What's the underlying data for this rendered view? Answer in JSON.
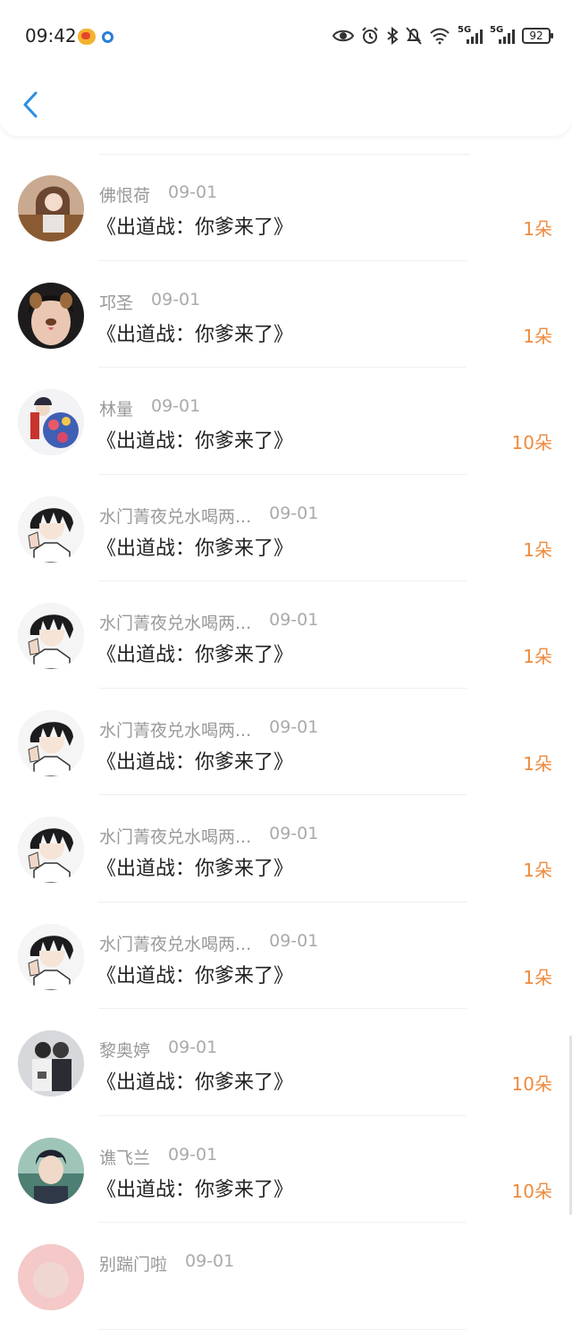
{
  "status_bar": {
    "time": "09:42",
    "battery": "92",
    "network_1": "5G",
    "network_2": "5G"
  },
  "colors": {
    "accent_orange": "#ef8a3c",
    "back_blue": "#2b8fe0"
  },
  "header": {
    "back_icon": "chevron-left-icon"
  },
  "rows": [
    {
      "name": "佛恨荷",
      "date": "09-01",
      "title": "《出道战：你爹来了》",
      "count": "1朵",
      "avatar": "photo-girl"
    },
    {
      "name": "邛圣",
      "date": "09-01",
      "title": "《出道战：你爹来了》",
      "count": "1朵",
      "avatar": "dog-filter-face"
    },
    {
      "name": "林量",
      "date": "09-01",
      "title": "《出道战：你爹来了》",
      "count": "10朵",
      "avatar": "anime-girl-flowers"
    },
    {
      "name": "水门菁夜兑水喝两...",
      "date": "09-01",
      "title": "《出道战：你爹来了》",
      "count": "1朵",
      "avatar": "anime-boy"
    },
    {
      "name": "水门菁夜兑水喝两...",
      "date": "09-01",
      "title": "《出道战：你爹来了》",
      "count": "1朵",
      "avatar": "anime-boy"
    },
    {
      "name": "水门菁夜兑水喝两...",
      "date": "09-01",
      "title": "《出道战：你爹来了》",
      "count": "1朵",
      "avatar": "anime-boy"
    },
    {
      "name": "水门菁夜兑水喝两...",
      "date": "09-01",
      "title": "《出道战：你爹来了》",
      "count": "1朵",
      "avatar": "anime-boy"
    },
    {
      "name": "水门菁夜兑水喝两...",
      "date": "09-01",
      "title": "《出道战：你爹来了》",
      "count": "1朵",
      "avatar": "anime-boy"
    },
    {
      "name": "黎奥婷",
      "date": "09-01",
      "title": "《出道战：你爹来了》",
      "count": "10朵",
      "avatar": "couple-photo"
    },
    {
      "name": "谯飞兰",
      "date": "09-01",
      "title": "《出道战：你爹来了》",
      "count": "10朵",
      "avatar": "boy-photo"
    },
    {
      "name": "别踹门啦",
      "date": "09-01",
      "title": "",
      "count": "",
      "avatar": "pink-photo"
    }
  ]
}
